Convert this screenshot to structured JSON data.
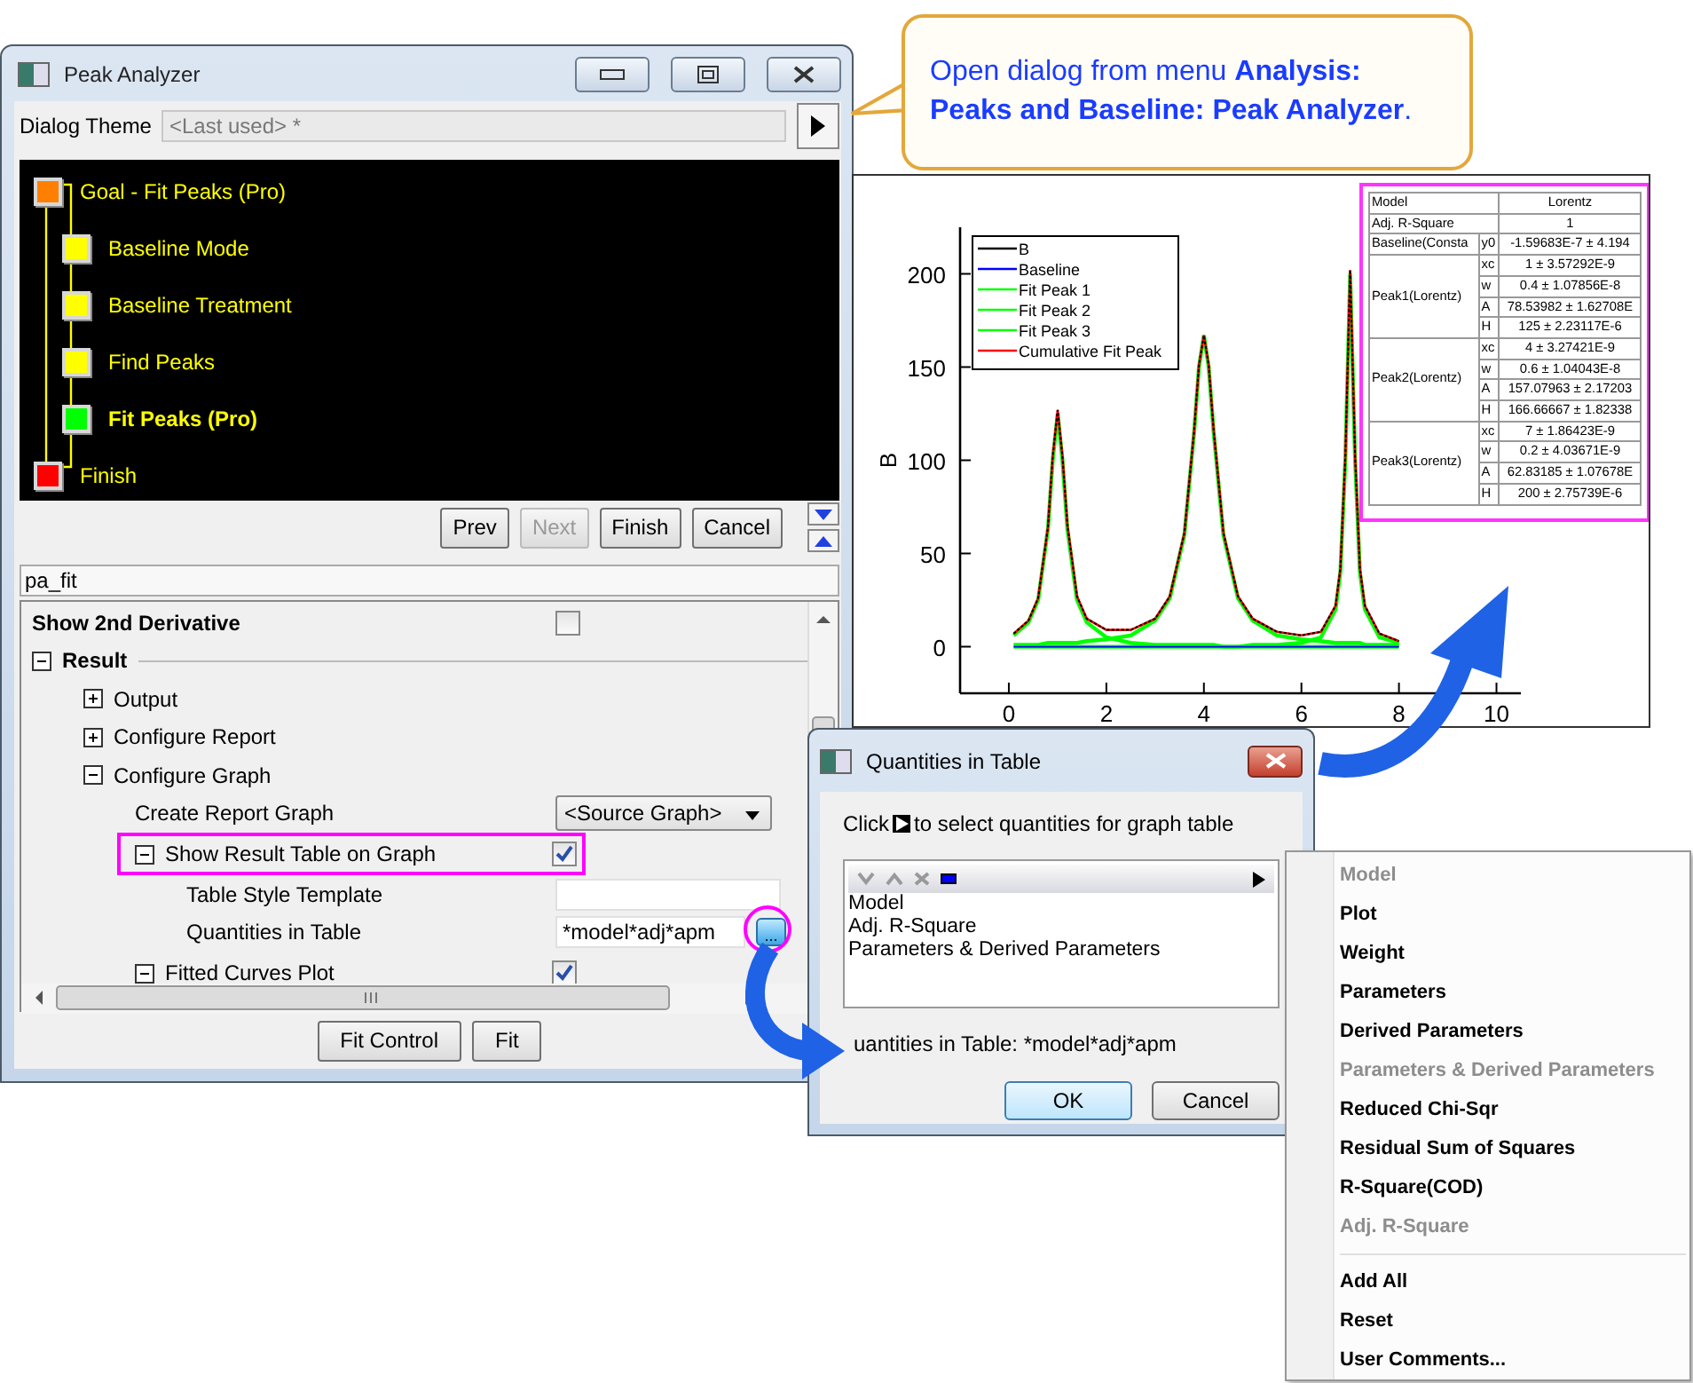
{
  "callout": {
    "text": "Open dialog from menu **Analysis: Peaks and Baseline: Peak Analyzer**."
  },
  "peak_analyzer": {
    "title": "Peak Analyzer",
    "theme_label": "Dialog Theme",
    "theme_value": "<Last used> *",
    "flow": [
      {
        "label": "Goal - Fit Peaks (Pro)",
        "color": "#ff8000",
        "selected": false,
        "children": [
          {
            "label": "Baseline Mode",
            "color": "#ffff00",
            "selected": false
          },
          {
            "label": "Baseline Treatment",
            "color": "#ffff00",
            "selected": false
          },
          {
            "label": "Find Peaks",
            "color": "#ffff00",
            "selected": false
          },
          {
            "label": "Fit Peaks (Pro)",
            "color": "#00ff00",
            "selected": true
          }
        ]
      },
      {
        "label": "Finish",
        "color": "#ff0000",
        "selected": false
      }
    ],
    "nav_buttons": [
      {
        "label": "Prev",
        "disabled": false
      },
      {
        "label": "Next",
        "disabled": true
      },
      {
        "label": "Finish",
        "disabled": false
      },
      {
        "label": "Cancel",
        "disabled": false
      }
    ],
    "name_value": "pa_fit",
    "properties": [
      {
        "kind": "check",
        "label": "Show 2nd Derivative",
        "checked": false
      },
      {
        "kind": "group",
        "label": "Result",
        "expanded": true,
        "children": [
          {
            "kind": "group",
            "label": "Output",
            "expanded": false
          },
          {
            "kind": "group",
            "label": "Configure Report",
            "expanded": false
          },
          {
            "kind": "group",
            "label": "Configure Graph",
            "expanded": true,
            "children": [
              {
                "kind": "dropdown",
                "label": "Create Report Graph",
                "value": "<Source Graph>"
              },
              {
                "kind": "check_group",
                "label": "Show Result Table on Graph",
                "expanded": true,
                "checked": true,
                "highlighted": true,
                "children": [
                  {
                    "kind": "text",
                    "label": "Table Style Template"
                  },
                  {
                    "kind": "text_button",
                    "label": "Quantities in Table",
                    "value": "*model*adj*apm",
                    "button": "...",
                    "highlighted": true
                  }
                ]
              },
              {
                "kind": "check_group",
                "label": "Fitted Curves Plot",
                "expanded": true,
                "checked": true,
                "highlighted": false
              }
            ]
          }
        ]
      }
    ],
    "bottom_buttons": [
      {
        "label": "Fit Control"
      },
      {
        "label": "Fit"
      }
    ]
  },
  "graph": {
    "chart_data": {
      "type": "line",
      "ylabel": "B",
      "legend": "upper left",
      "xlim": [
        -1,
        10.5
      ],
      "ylim": [
        -25,
        225
      ],
      "xticks": [
        0,
        2,
        4,
        6,
        8,
        10
      ],
      "yticks": [
        0,
        50,
        100,
        150,
        200
      ],
      "x": [
        0.1,
        0.4,
        0.6,
        0.8,
        0.9,
        1.0,
        1.1,
        1.2,
        1.4,
        1.6,
        2.0,
        2.5,
        3.0,
        3.3,
        3.6,
        3.8,
        3.9,
        4.0,
        4.1,
        4.2,
        4.4,
        4.7,
        5.0,
        5.5,
        6.0,
        6.4,
        6.7,
        6.8,
        6.9,
        7.0,
        7.1,
        7.2,
        7.3,
        7.6,
        8.0
      ],
      "series": [
        {
          "name": "B",
          "color": "#000000",
          "line_style": "dashed",
          "values": [
            7,
            14,
            26,
            64,
            102,
            127,
            102,
            65,
            27,
            15,
            9,
            9,
            15,
            27,
            61,
            116,
            151,
            167,
            151,
            116,
            61,
            27,
            15,
            8,
            6,
            8,
            22,
            42,
            102,
            202,
            102,
            42,
            22,
            7,
            3
          ]
        },
        {
          "name": "Baseline",
          "color": "#0000ff",
          "values": [
            0,
            0,
            0,
            0,
            0,
            0,
            0,
            0,
            0,
            0,
            0,
            0,
            0,
            0,
            0,
            0,
            0,
            0,
            0,
            0,
            0,
            0,
            0,
            0,
            0,
            0,
            0,
            0,
            0,
            0,
            0,
            0,
            0,
            0,
            0
          ]
        },
        {
          "name": "Fit Peak 1",
          "color": "#00ff00",
          "values": [
            6,
            13,
            25,
            63,
            100,
            125,
            100,
            63,
            25,
            13,
            5,
            2,
            1,
            1,
            1,
            1,
            1,
            1,
            1,
            1,
            0,
            0,
            0,
            0,
            0,
            0,
            0,
            0,
            0,
            0,
            0,
            0,
            0,
            0,
            0
          ]
        },
        {
          "name": "Fit Peak 2",
          "color": "#00ff00",
          "values": [
            1,
            1,
            1,
            2,
            2,
            2,
            2,
            2,
            2,
            3,
            4,
            6,
            14,
            26,
            60,
            115,
            150,
            167,
            150,
            115,
            60,
            26,
            14,
            6,
            4,
            3,
            2,
            2,
            2,
            2,
            2,
            2,
            1,
            1,
            1
          ]
        },
        {
          "name": "Fit Peak 3",
          "color": "#00ff00",
          "values": [
            0,
            0,
            0,
            0,
            0,
            0,
            0,
            0,
            0,
            0,
            0,
            0,
            0,
            0,
            0,
            0,
            0,
            0,
            0,
            0,
            0,
            0,
            1,
            1,
            2,
            5,
            20,
            40,
            100,
            200,
            100,
            40,
            20,
            5,
            2
          ]
        },
        {
          "name": "Cumulative Fit Peak",
          "color": "#ff0000",
          "values": [
            7,
            14,
            26,
            64,
            102,
            127,
            102,
            65,
            27,
            15,
            9,
            9,
            15,
            27,
            61,
            116,
            151,
            167,
            151,
            116,
            61,
            27,
            15,
            8,
            6,
            8,
            22,
            42,
            102,
            202,
            102,
            42,
            22,
            7,
            3
          ]
        }
      ]
    },
    "result_table": {
      "header": {
        "label": "Model",
        "value": "Lorentz"
      },
      "rows": [
        {
          "label": "Adj. R-Square",
          "value": "1"
        },
        {
          "label": "Baseline(Consta",
          "params": [
            {
              "name": "y0",
              "value": "-1.59683E-7 ± 4.194"
            }
          ]
        },
        {
          "label": "Peak1(Lorentz)",
          "params": [
            {
              "name": "xc",
              "value": "1 ± 3.57292E-9"
            },
            {
              "name": "w",
              "value": "0.4 ± 1.07856E-8"
            },
            {
              "name": "A",
              "value": "78.53982 ± 1.62708E"
            },
            {
              "name": "H",
              "value": "125 ± 2.23117E-6"
            }
          ]
        },
        {
          "label": "Peak2(Lorentz)",
          "params": [
            {
              "name": "xc",
              "value": "4 ± 3.27421E-9"
            },
            {
              "name": "w",
              "value": "0.6 ± 1.04043E-8"
            },
            {
              "name": "A",
              "value": "157.07963 ± 2.17203"
            },
            {
              "name": "H",
              "value": "166.66667 ± 1.82338"
            }
          ]
        },
        {
          "label": "Peak3(Lorentz)",
          "params": [
            {
              "name": "xc",
              "value": "7 ± 1.86423E-9"
            },
            {
              "name": "w",
              "value": "0.2 ± 4.03671E-9"
            },
            {
              "name": "A",
              "value": "62.83185 ± 1.07678E"
            },
            {
              "name": "H",
              "value": "200 ± 2.75739E-6"
            }
          ]
        }
      ]
    }
  },
  "quantities_dialog": {
    "title": "Quantities in Table",
    "instruction_before": "Click",
    "instruction_after": "to select quantities for graph table",
    "list_items": [
      "Model",
      "Adj. R-Square",
      "Parameters & Derived Parameters"
    ],
    "summary": "uantities in Table: *model*adj*apm",
    "buttons": [
      {
        "label": "OK",
        "selected": true
      },
      {
        "label": "Cancel",
        "selected": false
      }
    ]
  },
  "context_menu": {
    "groups": [
      {
        "items": [
          {
            "label": "Model",
            "disabled": true
          },
          {
            "label": "Plot",
            "disabled": false
          },
          {
            "label": "Weight",
            "disabled": false
          },
          {
            "label": "Parameters",
            "disabled": false
          },
          {
            "label": "Derived Parameters",
            "disabled": false
          },
          {
            "label": "Parameters & Derived Parameters",
            "disabled": true
          },
          {
            "label": "Reduced Chi-Sqr",
            "disabled": false
          },
          {
            "label": "Residual Sum of Squares",
            "disabled": false
          },
          {
            "label": "R-Square(COD)",
            "disabled": false
          },
          {
            "label": "Adj. R-Square",
            "disabled": true
          }
        ]
      },
      {
        "items": [
          {
            "label": "Add All",
            "disabled": false
          },
          {
            "label": "Reset",
            "disabled": false
          },
          {
            "label": "User Comments...",
            "disabled": false
          }
        ]
      }
    ]
  }
}
